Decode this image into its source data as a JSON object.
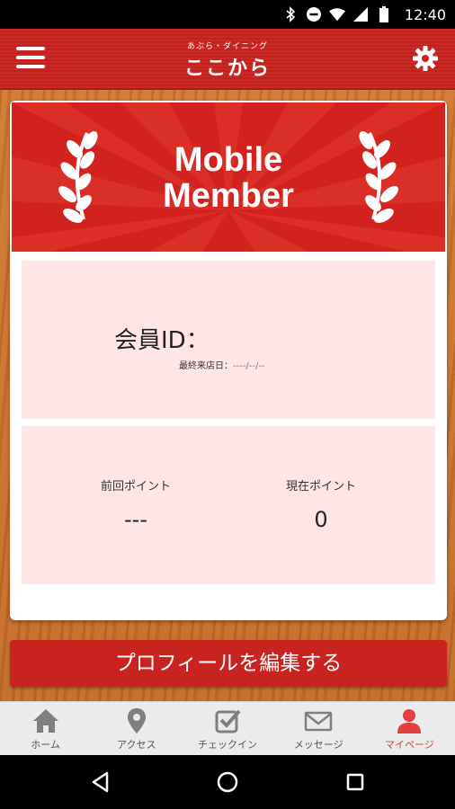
{
  "status_bar": {
    "time": "12:40",
    "icons": [
      "bluetooth-icon",
      "do-not-disturb-icon",
      "wifi-icon",
      "signal-icon",
      "battery-icon"
    ]
  },
  "header": {
    "logo_sub": "あぶら・ダイニング",
    "logo_main": "ここから",
    "menu_icon": "hamburger-icon",
    "settings_icon": "gear-icon"
  },
  "banner": {
    "line1": "Mobile",
    "line2": "Member"
  },
  "member": {
    "id_label": "会員ID：",
    "last_visit_label": "最終来店日：",
    "last_visit_value": "----/--/--"
  },
  "points": {
    "previous_label": "前回ポイント",
    "previous_value": "---",
    "current_label": "現在ポイント",
    "current_value": "0"
  },
  "edit_button": "プロフィールを編集する",
  "tabs": [
    {
      "label": "ホーム",
      "icon": "home-icon",
      "active": false
    },
    {
      "label": "アクセス",
      "icon": "map-pin-icon",
      "active": false
    },
    {
      "label": "チェックイン",
      "icon": "checkbox-icon",
      "active": false
    },
    {
      "label": "メッセージ",
      "icon": "envelope-icon",
      "active": false
    },
    {
      "label": "マイページ",
      "icon": "user-icon",
      "active": true
    }
  ],
  "colors": {
    "brand_red": "#c8231f",
    "panel_pink": "#ffe6e6",
    "active_tab": "#e2403e"
  }
}
